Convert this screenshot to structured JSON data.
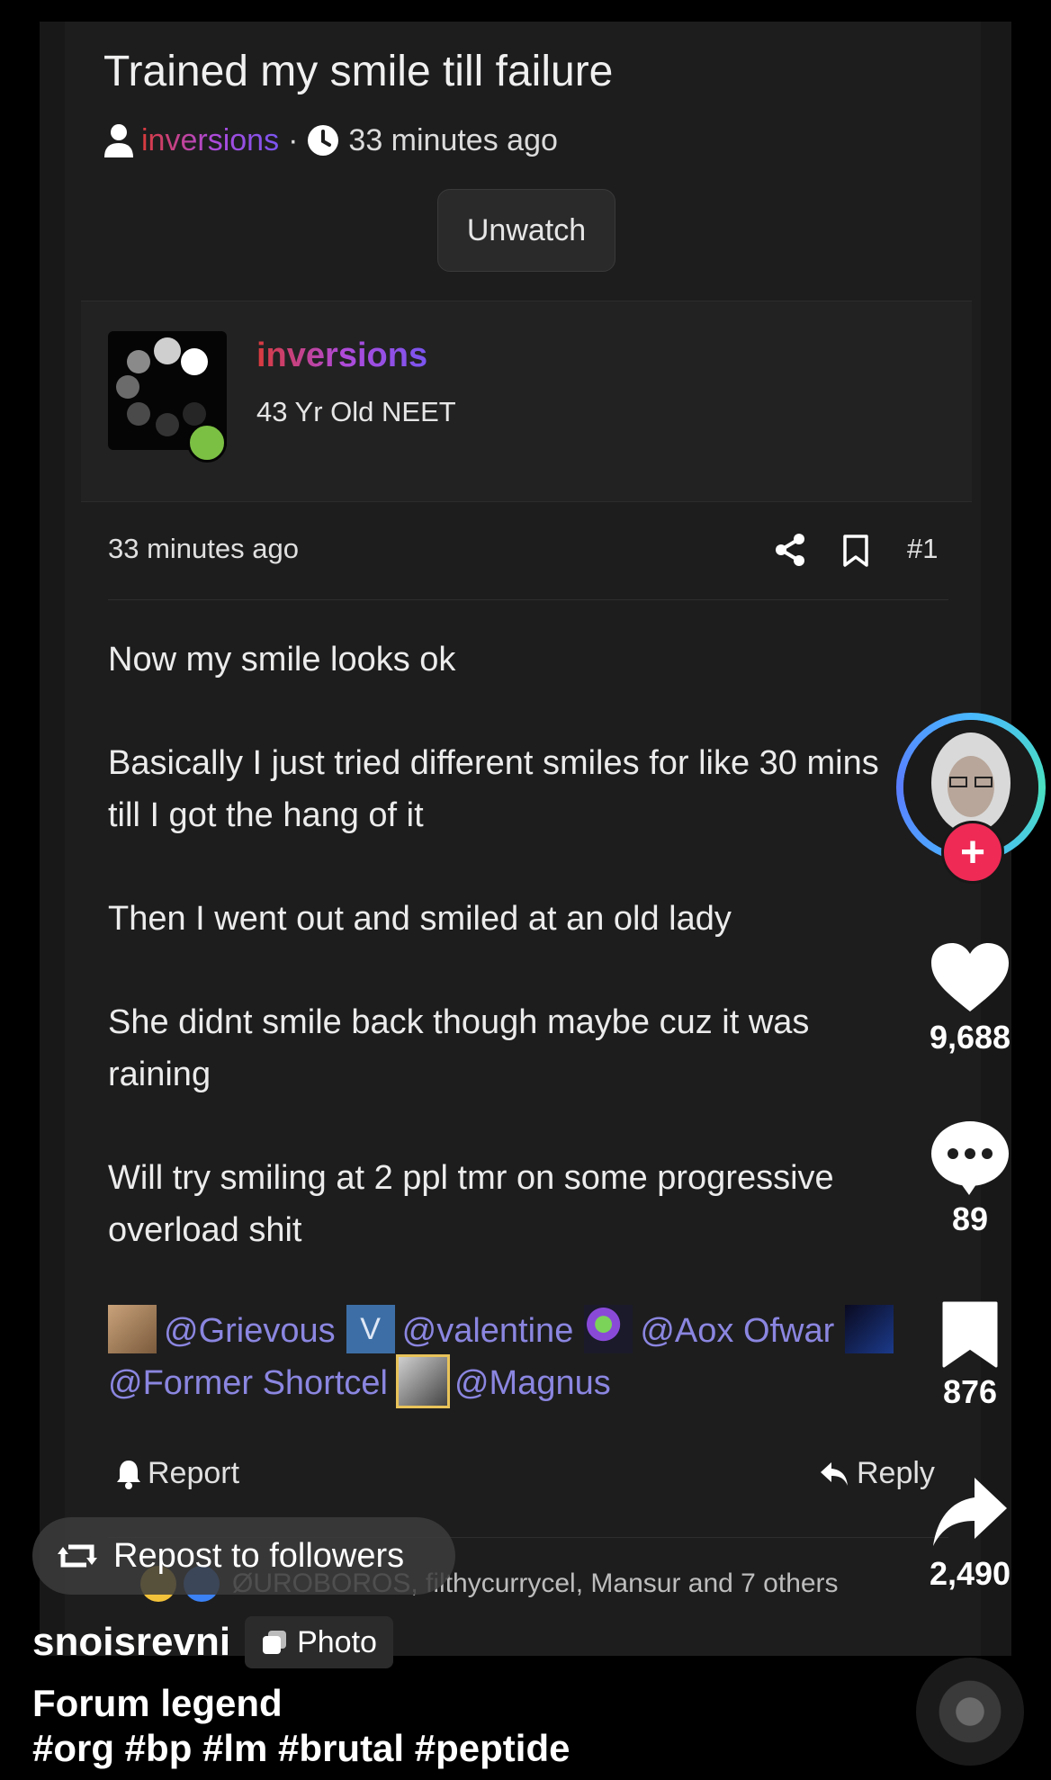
{
  "thread": {
    "title": "Trained my smile till failure",
    "author": "inversions",
    "separator": "·",
    "time_ago": "33 minutes ago",
    "unwatch_label": "Unwatch"
  },
  "author_card": {
    "name": "inversions",
    "tagline": "43 Yr Old NEET"
  },
  "post": {
    "time_ago": "33 minutes ago",
    "number": "#1",
    "paragraphs": [
      "Now my smile looks ok",
      "Basically I just tried different smiles for like 30 mins till I got the hang of it",
      "Then I went out and smiled at an old lady",
      "She didnt smile back though maybe cuz it was raining",
      "Will try smiling at 2 ppl tmr on some progressive overload shit"
    ],
    "mentions": {
      "grievous": "@Grievous",
      "valentine_badge": "V",
      "valentine": "@valentine",
      "aox": "@Aox Ofwar",
      "former": "@Former Shortcel",
      "magnus": "@Magnus"
    },
    "report_label": "Report",
    "reply_label": "Reply",
    "reactions_text": "ØUROBOROS, filthycurrycel, Mansur and 7 others"
  },
  "tiktok": {
    "repost_label": "Repost to followers",
    "creator": "snoisrevni",
    "photo_label": "Photo",
    "caption_title": "Forum legend",
    "hashtags": "#org #bp #lm #brutal #peptide",
    "likes": "9,688",
    "comments": "89",
    "saves": "876",
    "shares": "2,490"
  },
  "colors": {
    "background": "#000000",
    "panel": "#1d1d1e",
    "mention": "#8b86e0",
    "follow": "#ee2a55",
    "online": "#7bc043"
  }
}
